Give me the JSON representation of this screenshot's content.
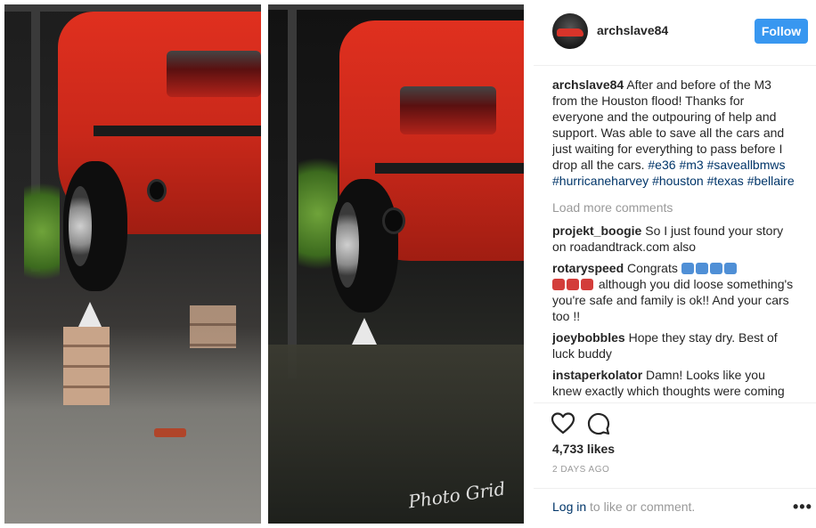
{
  "post": {
    "watermark": "Photo Grid"
  },
  "header": {
    "username": "archslave84",
    "follow_label": "Follow"
  },
  "caption": {
    "username": "archslave84",
    "text": "After and before of the M3 from the Houston flood! Thanks for everyone and the outpouring of help and support. Was able to save all the cars and just waiting for everything to pass before I drop all the cars.",
    "hashtags": [
      "#e36",
      "#m3",
      "#saveallbmws",
      "#hurricaneharvey",
      "#houston",
      "#texas",
      "#bellaire"
    ]
  },
  "load_more_label": "Load more comments",
  "comments": [
    {
      "username": "projekt_boogie",
      "text": "So I just found your story on roadandtrack.com also"
    },
    {
      "username": "rotaryspeed",
      "text_a": "Congrats",
      "text_b": "although you did loose something's you're safe and family is ok!! And your cars too !!"
    },
    {
      "username": "joeybobbles",
      "text": "Hope they stay dry. Best of luck buddy"
    },
    {
      "username": "instaperkolator",
      "text": "Damn! Looks like you knew exactly which thoughts were coming in that"
    }
  ],
  "actions": {
    "like_icon": "heart-icon",
    "comment_icon": "comment-bubble-icon",
    "likes": "4,733 likes",
    "timestamp": "2 DAYS AGO"
  },
  "footer": {
    "login_link": "Log in",
    "login_rest": " to like or comment.",
    "more_icon": "•••"
  },
  "colors": {
    "follow_bg": "#3897f0",
    "link": "#003569",
    "muted": "#999999",
    "car_red": "#d8342a"
  }
}
